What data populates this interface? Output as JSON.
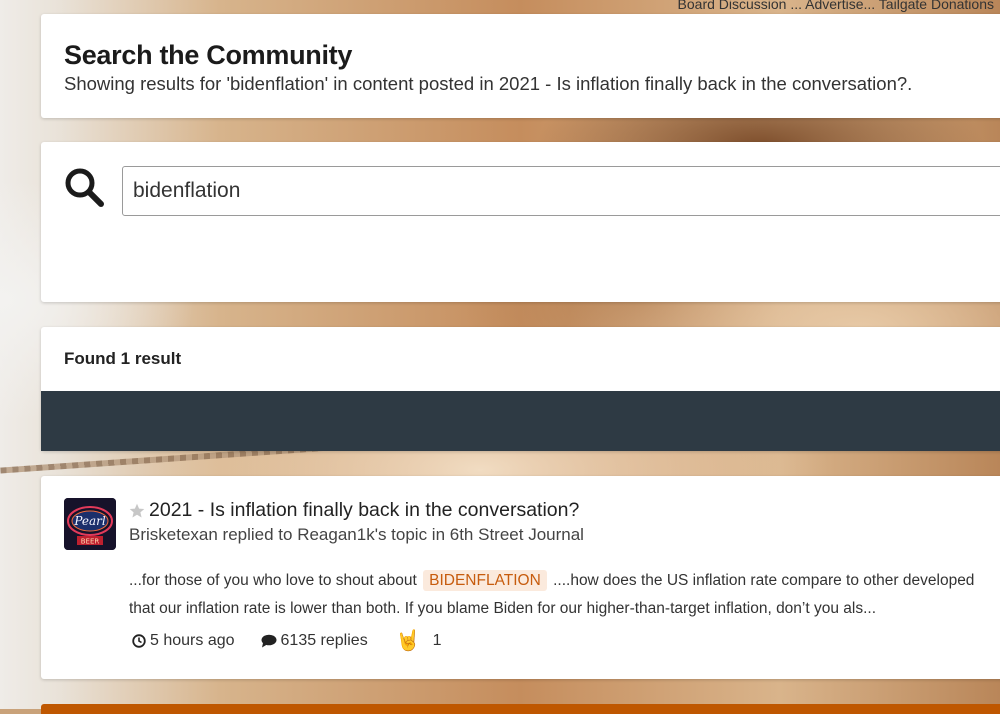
{
  "topnav": {
    "links_text": "Board Discussion ... Advertise... Tailgate Donations"
  },
  "header": {
    "title": "Search the Community",
    "subtitle": "Showing results for 'bidenflation' in content posted in 2021 - Is inflation finally back in the conversation?."
  },
  "search": {
    "icon": "search-icon",
    "value": "bidenflation"
  },
  "results": {
    "found_label": "Found 1 result"
  },
  "result": {
    "avatar_text": "Pearl",
    "avatar_subtext": "BEER",
    "title": "2021 - Is inflation finally back in the conversation?",
    "meta": "Brisketexan replied to Reagan1k's topic in 6th Street Journal",
    "snippet_before": "...for those of you who love to shout about",
    "snippet_highlight": "BIDENFLATION",
    "snippet_after": "....how does the US inflation rate compare to other developed",
    "snippet_line2": "that our inflation rate is lower than both. If you blame Biden for our higher-than-target inflation, don’t you als...",
    "time": "5 hours ago",
    "replies": "6135 replies",
    "reaction_count": "1",
    "reaction_icon": "🤘"
  },
  "colors": {
    "accent": "#bf5700",
    "dark_bar": "#2e3a44",
    "highlight_bg": "#fbeadd",
    "highlight_text": "#c75c0e"
  }
}
